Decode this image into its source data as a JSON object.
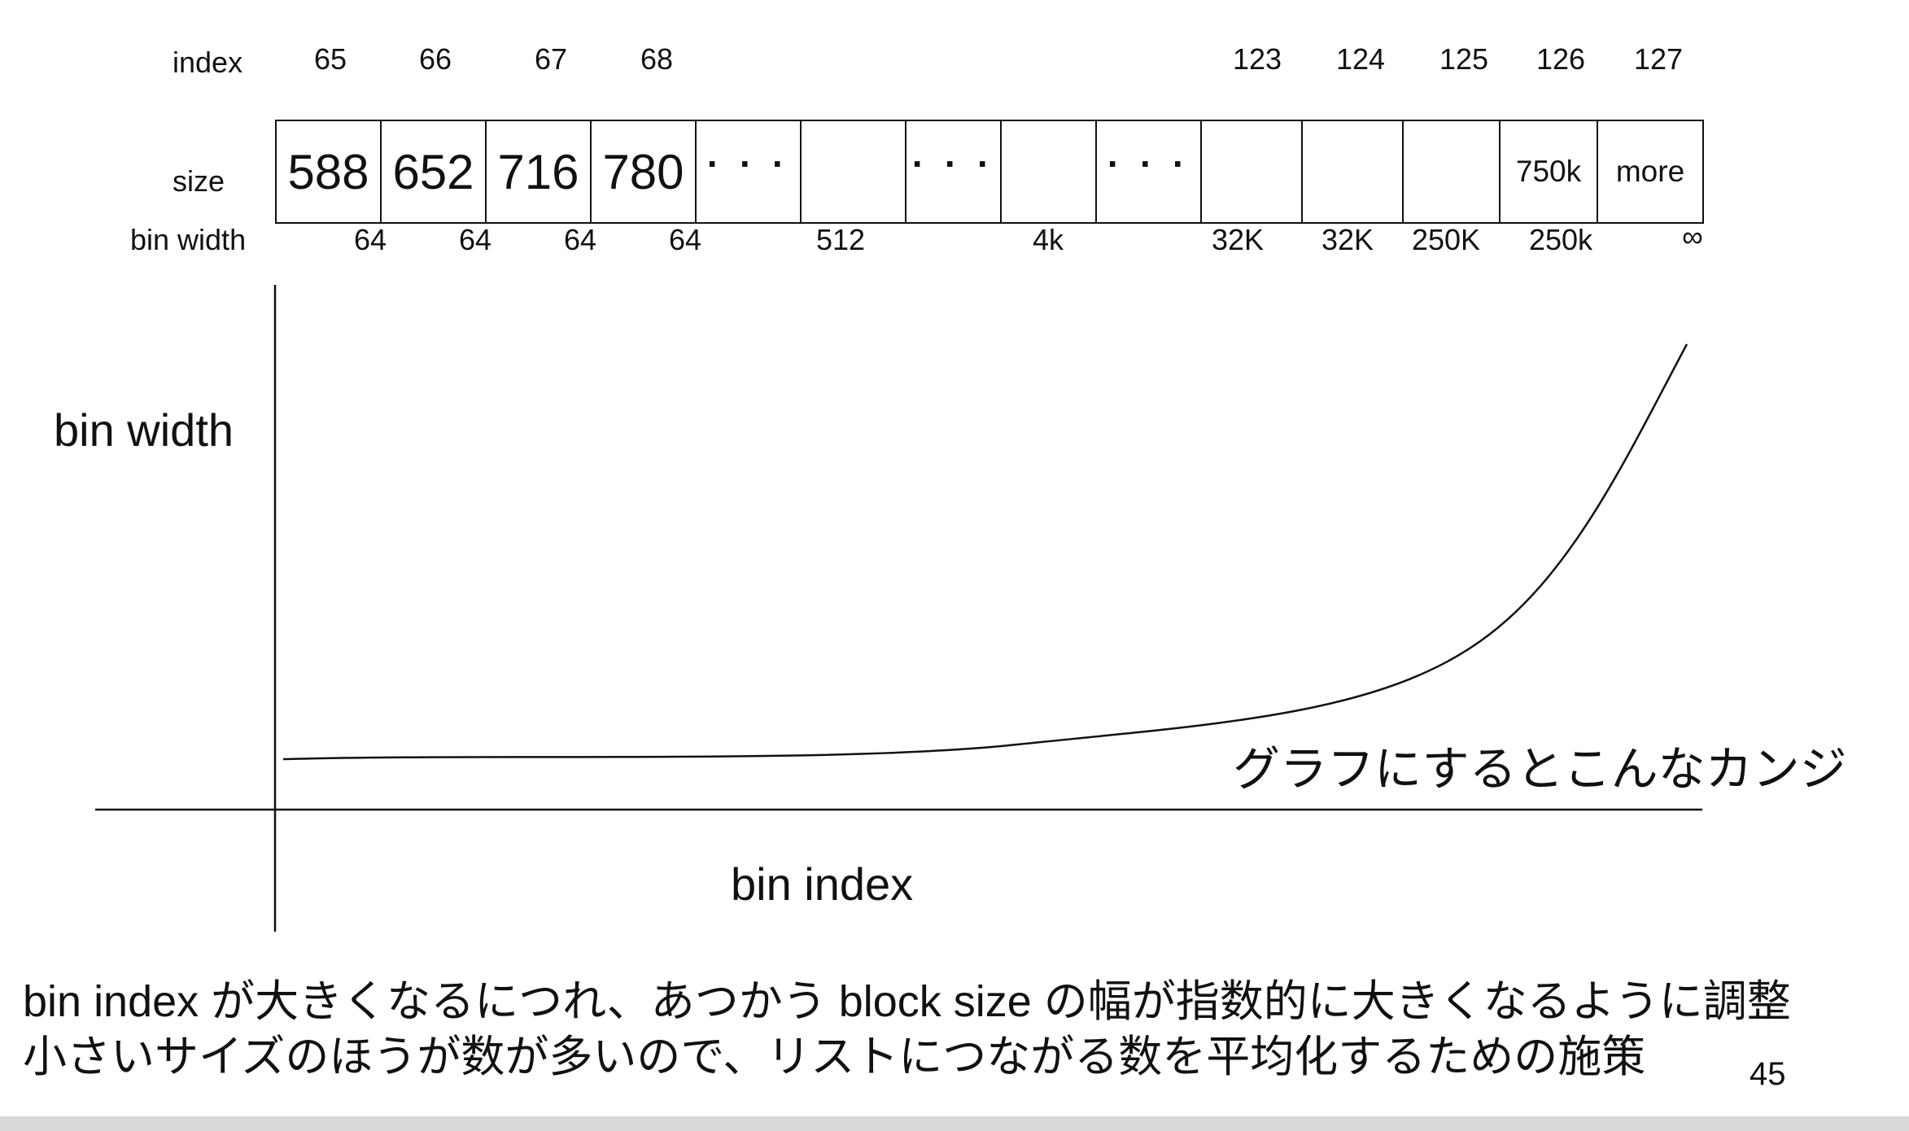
{
  "table": {
    "row_labels": {
      "index": "index",
      "size": "size",
      "bin_width": "bin width"
    },
    "indices": [
      "65",
      "66",
      "67",
      "68",
      "123",
      "124",
      "125",
      "126",
      "127"
    ],
    "cells": [
      "588",
      "652",
      "716",
      "780",
      "· · ·",
      "",
      "· · ·",
      "",
      "· · ·",
      "",
      "",
      "",
      "750k",
      "more"
    ],
    "bin_widths": [
      "64",
      "64",
      "64",
      "64",
      "512",
      "4k",
      "32K",
      "32K",
      "250K",
      "250k",
      "∞"
    ]
  },
  "graph": {
    "y_label": "bin width",
    "x_label": "bin index",
    "annotation": "グラフにするとこんなカンジ",
    "curve_color": "#111111"
  },
  "footer": {
    "line1": "bin index が大きくなるにつれ、あつかう block size の幅が指数的に大きくなるように調整",
    "line2": "小さいサイズのほうが数が多いので、リストにつながる数を平均化するための施策"
  },
  "page_number": "45"
}
